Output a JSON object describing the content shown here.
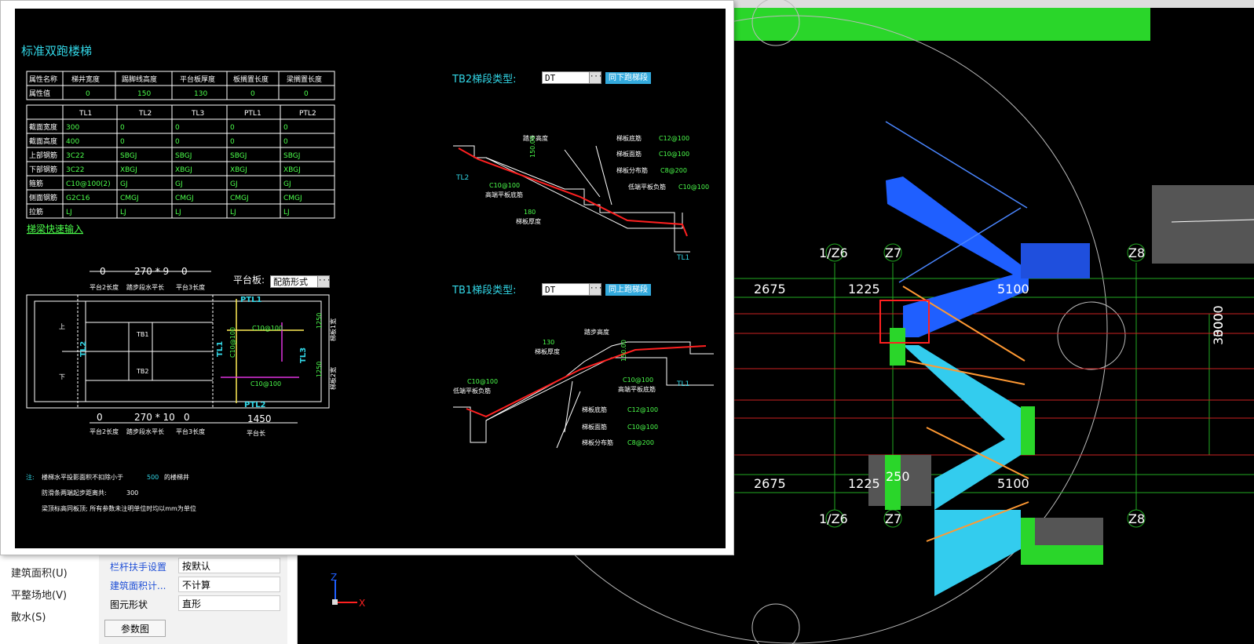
{
  "dialog": {
    "title": "标准双跑楼梯",
    "attr_table": {
      "headers": [
        "属性名称",
        "梯井宽度",
        "踢脚线高度",
        "平台板厚度",
        "板搁置长度",
        "梁搁置长度"
      ],
      "row_label": "属性值",
      "values": [
        "0",
        "150",
        "130",
        "0",
        "0"
      ]
    },
    "beam_table": {
      "columns": [
        "",
        "TL1",
        "TL2",
        "TL3",
        "PTL1",
        "PTL2"
      ],
      "rows": [
        [
          "截面宽度",
          "300",
          "0",
          "0",
          "0",
          "0"
        ],
        [
          "截面高度",
          "400",
          "0",
          "0",
          "0",
          "0"
        ],
        [
          "上部钢筋",
          "3C22",
          "SBGJ",
          "SBGJ",
          "SBGJ",
          "SBGJ"
        ],
        [
          "下部钢筋",
          "3C22",
          "XBGJ",
          "XBGJ",
          "XBGJ",
          "XBGJ"
        ],
        [
          "箍筋",
          "C10@100(2)",
          "GJ",
          "GJ",
          "GJ",
          "GJ"
        ],
        [
          "侧面钢筋",
          "G2C16",
          "CMGJ",
          "CMGJ",
          "CMGJ",
          "CMGJ"
        ],
        [
          "拉筋",
          "LJ",
          "LJ",
          "LJ",
          "LJ",
          "LJ"
        ]
      ]
    },
    "quick_input_link": "梯梁快速输入",
    "plan": {
      "top_dims": [
        "0",
        "270 * 9",
        "0"
      ],
      "top_labels": [
        "平台2长度",
        "踏步段水平长",
        "平台3长度"
      ],
      "bottom_dims": [
        "0",
        "270 * 10",
        "0",
        "1450"
      ],
      "bottom_labels": [
        "平台2长度",
        "踏步段水平长",
        "平台3长度",
        "平台长"
      ],
      "platform_label": "平台板:",
      "platform_value": "配筋形式",
      "labels": {
        "up": "上",
        "down": "下",
        "tb1": "TB1",
        "tb2": "TB2",
        "tl2": "TL2",
        "tl1": "TL1",
        "tl3": "TL3",
        "ptl1": "PTL1",
        "ptl2": "PTL2",
        "bar1": "C10@100",
        "bar2": "C10@100",
        "bar3": "C10@100",
        "w1": "1250",
        "w2": "1250",
        "wl1": "梯板1宽",
        "wl2": "梯板2宽"
      }
    },
    "notes": {
      "prefix": "注:",
      "line1a": "楼梯水平投影面积不扣除小于",
      "line1v": "500",
      "line1b": "的楼梯井",
      "line2a": "防滑条两端起步距离共:",
      "line2v": "300",
      "line3": "梁顶标高同板顶; 所有参数未注明单位时均以mm为单位"
    },
    "tb2": {
      "title": "TB2梯段类型:",
      "value": "DT",
      "button": "同下跑梯段",
      "labels": {
        "step_h": "踏步高度",
        "step_v": "150.00",
        "bot_bar": "梯板底筋",
        "bot_v": "C12@100",
        "top_bar": "梯板面筋",
        "top_v": "C10@100",
        "dist_bar": "梯板分布筋",
        "dist_v": "C8@200",
        "low_neg": "低端平板负筋",
        "low_v": "C10@100",
        "high_bot_v": "C10@100",
        "high_bot": "高端平板底筋",
        "thick_v": "180",
        "thick": "梯板厚度",
        "tl2": "TL2",
        "tl1": "TL1"
      }
    },
    "tb1": {
      "title": "TB1梯段类型:",
      "value": "DT",
      "button": "同上跑梯段",
      "labels": {
        "step_h": "踏步高度",
        "step_v": "150.00",
        "thick_v": "130",
        "thick": "梯板厚度",
        "low_v": "C10@100",
        "low_neg": "低端平板负筋",
        "high_v": "C10@100",
        "high_bot": "高端平板底筋",
        "tl1": "TL1",
        "bot_bar": "梯板底筋",
        "bot_v": "C12@100",
        "top_bar": "梯板面筋",
        "top_v": "C10@100",
        "dist_bar": "梯板分布筋",
        "dist_v": "C8@200"
      }
    }
  },
  "canvas": {
    "axis_labels": [
      "1/Z6",
      "Z7",
      "Z8",
      "1/Z6",
      "Z7",
      "Z8"
    ],
    "dims": [
      "2675",
      "1225",
      "5100",
      "2675",
      "1225",
      "5100",
      "250",
      "3000",
      "3000"
    ],
    "ucs": {
      "x": "X",
      "z": "Z"
    }
  },
  "left_nav": [
    "建筑面积(U)",
    "平整场地(V)",
    "散水(S)"
  ],
  "properties": [
    {
      "name": "栏杆扶手设置",
      "value": "按默认"
    },
    {
      "name": "建筑面积计...",
      "value": "不计算"
    },
    {
      "name": "图元形状",
      "value": "直形"
    }
  ],
  "param_button": "参数图",
  "colors": {
    "cad_bg": "#000000",
    "cyan": "#32d6e6",
    "green": "#4cff4c",
    "red": "#ff2020",
    "blue": "#1f5fff",
    "light_blue": "#33ccee",
    "orange": "#ff9933"
  }
}
